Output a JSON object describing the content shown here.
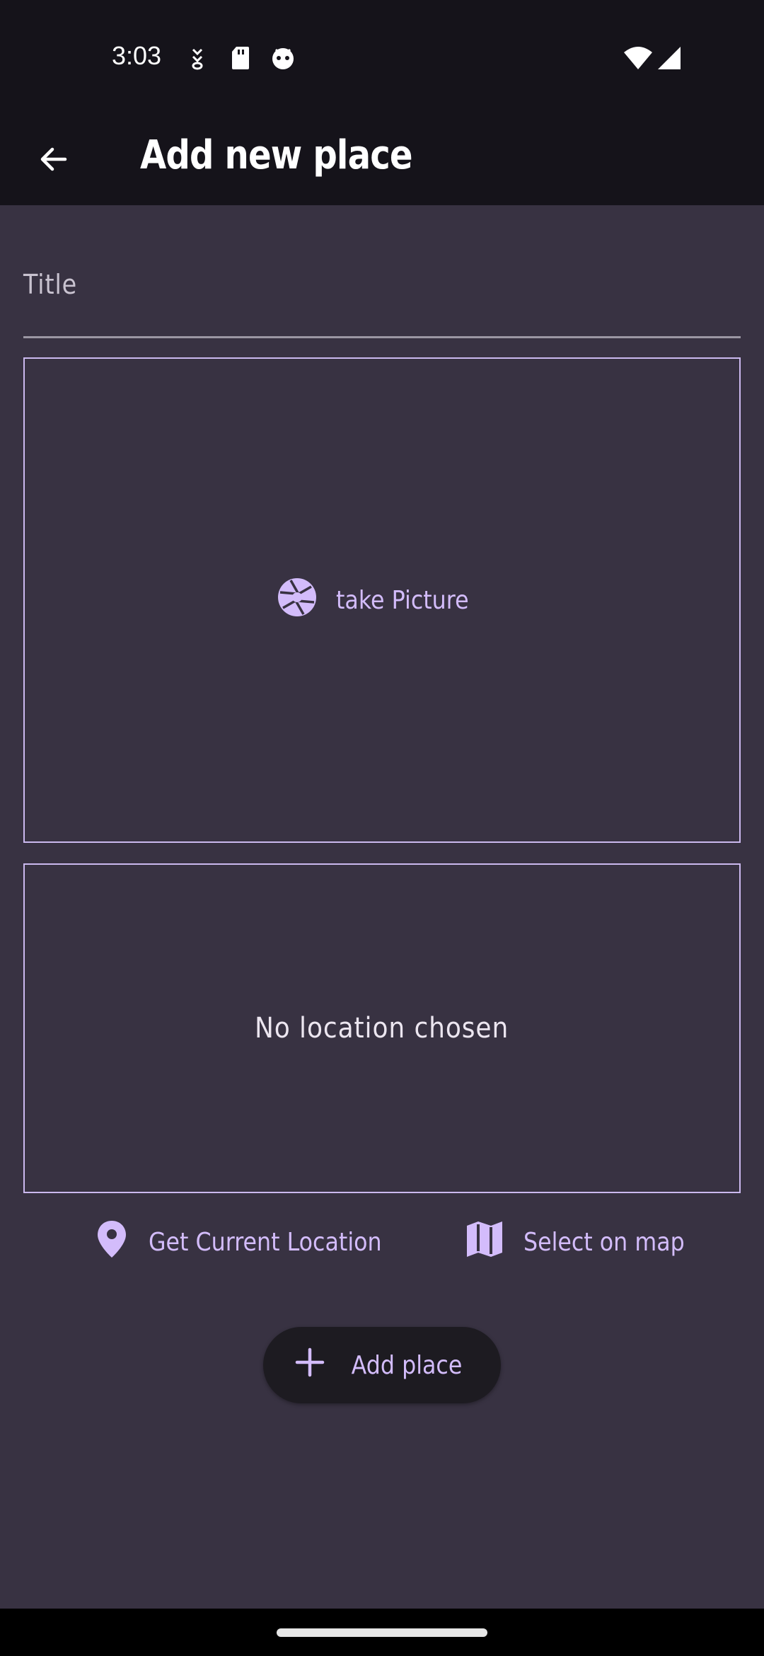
{
  "status_bar": {
    "time": "3:03",
    "icons": [
      "download-icon",
      "sd-card-icon",
      "android-debug-icon",
      "wifi-icon",
      "signal-icon"
    ]
  },
  "app_bar": {
    "title": "Add new place",
    "back_icon": "arrow-back-icon"
  },
  "form": {
    "title_label": "Title",
    "image_picker": {
      "label": "take Picture",
      "icon": "camera-shutter-icon"
    },
    "location": {
      "empty_text": "No location chosen",
      "current_location_label": "Get Current Location",
      "current_location_icon": "location-pin-icon",
      "select_on_map_label": "Select on map",
      "select_on_map_icon": "map-icon"
    },
    "submit_label": "Add place",
    "submit_icon": "plus-icon"
  },
  "colors": {
    "background": "#383242",
    "bar": "#15131a",
    "accent": "#d3bcfb",
    "border": "#cbb9ef"
  }
}
